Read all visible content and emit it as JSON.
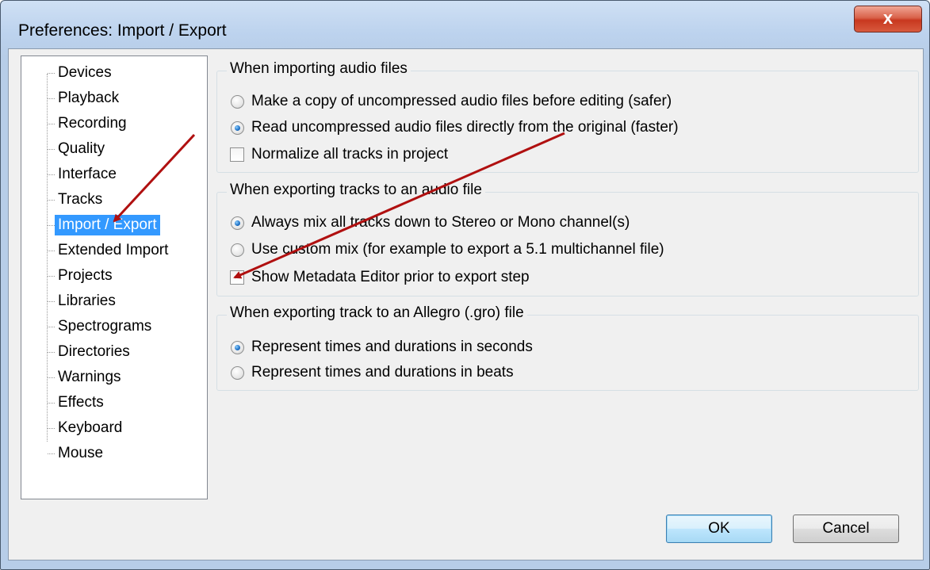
{
  "window": {
    "title": "Preferences: Import / Export",
    "close_label": "x"
  },
  "tree": {
    "items": [
      {
        "label": "Devices"
      },
      {
        "label": "Playback"
      },
      {
        "label": "Recording"
      },
      {
        "label": "Quality"
      },
      {
        "label": "Interface"
      },
      {
        "label": "Tracks"
      },
      {
        "label": "Import / Export",
        "selected": true
      },
      {
        "label": "Extended Import"
      },
      {
        "label": "Projects"
      },
      {
        "label": "Libraries"
      },
      {
        "label": "Spectrograms"
      },
      {
        "label": "Directories"
      },
      {
        "label": "Warnings"
      },
      {
        "label": "Effects"
      },
      {
        "label": "Keyboard"
      },
      {
        "label": "Mouse"
      }
    ]
  },
  "groups": {
    "import": {
      "label": "When importing audio files",
      "options": [
        {
          "label": "Make a copy of uncompressed audio files before editing (safer)",
          "type": "radio",
          "checked": false
        },
        {
          "label": "Read uncompressed audio files directly from the original (faster)",
          "type": "radio",
          "checked": true
        },
        {
          "label": "Normalize all tracks in project",
          "type": "checkbox",
          "checked": false
        }
      ]
    },
    "export": {
      "label": "When exporting tracks to an audio file",
      "options": [
        {
          "label": "Always mix all tracks down to Stereo or Mono channel(s)",
          "type": "radio",
          "checked": true
        },
        {
          "label": "Use custom mix (for example to export a 5.1 multichannel file)",
          "type": "radio",
          "checked": false
        },
        {
          "label": "Show Metadata Editor prior to export step",
          "type": "checkbox",
          "checked": false
        }
      ]
    },
    "allegro": {
      "label": "When exporting track to an Allegro (.gro) file",
      "options": [
        {
          "label": "Represent times and durations in seconds",
          "type": "radio",
          "checked": true
        },
        {
          "label": "Represent times and durations in beats",
          "type": "radio",
          "checked": false
        }
      ]
    }
  },
  "buttons": {
    "ok": "OK",
    "cancel": "Cancel"
  },
  "colors": {
    "selection": "#3399ff",
    "annotation_arrow": "#b01010"
  }
}
